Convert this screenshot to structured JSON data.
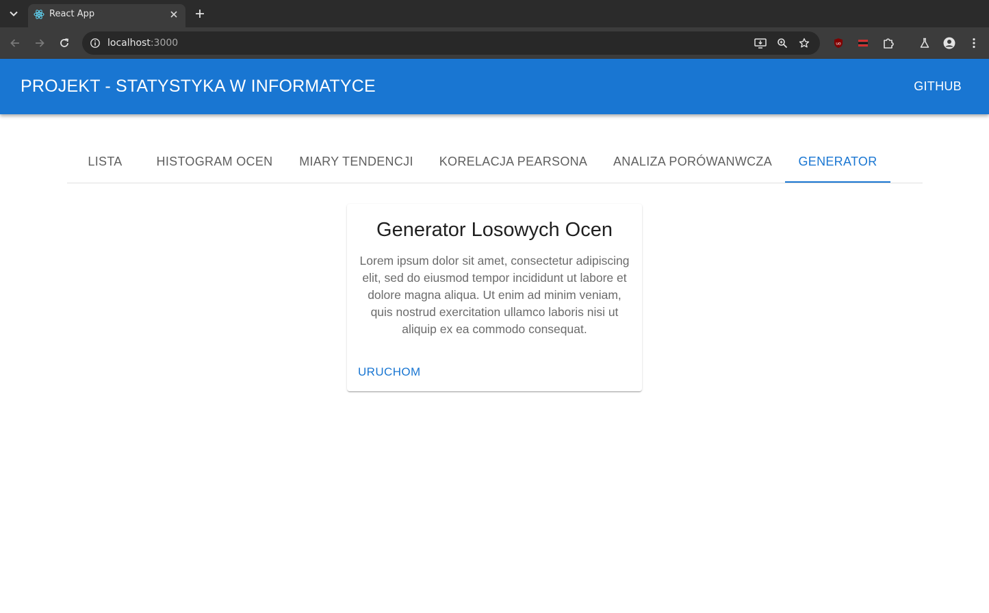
{
  "browser": {
    "tab_title": "React App",
    "url_host": "localhost",
    "url_port": ":3000",
    "colors": {
      "tabstrip": "#2b2b2b",
      "toolbar": "#3c3c3c",
      "omnibox": "#282828"
    },
    "icons": [
      "tab-search-icon",
      "react-logo-icon",
      "close-icon",
      "plus-icon",
      "back-arrow-icon",
      "forward-arrow-icon",
      "reload-icon",
      "site-info-icon",
      "install-app-icon",
      "zoom-icon",
      "star-icon",
      "ublock-icon",
      "extension-red-icon",
      "puzzle-icon",
      "labs-flask-icon",
      "profile-icon",
      "more-vert-icon"
    ]
  },
  "appbar": {
    "title": "PROJEKT - STATYSTYKA W INFORMATYCE",
    "github_label": "GITHUB",
    "color": "#1976d2"
  },
  "tabs": {
    "items": [
      {
        "label": "LISTA"
      },
      {
        "label": "HISTOGRAM OCEN"
      },
      {
        "label": "MIARY TENDENCJI"
      },
      {
        "label": "KORELACJA PEARSONA"
      },
      {
        "label": "ANALIZA PORÓWANWCZA"
      },
      {
        "label": "GENERATOR"
      }
    ],
    "active": "GENERATOR"
  },
  "card": {
    "title": "Generator Losowych Ocen",
    "body": "Lorem ipsum dolor sit amet, consectetur adipiscing elit, sed do eiusmod tempor incididunt ut labore et dolore magna aliqua. Ut enim ad minim veniam, quis nostrud exercitation ullamco laboris nisi ut aliquip ex ea commodo consequat.",
    "action_label": "URUCHOM"
  }
}
